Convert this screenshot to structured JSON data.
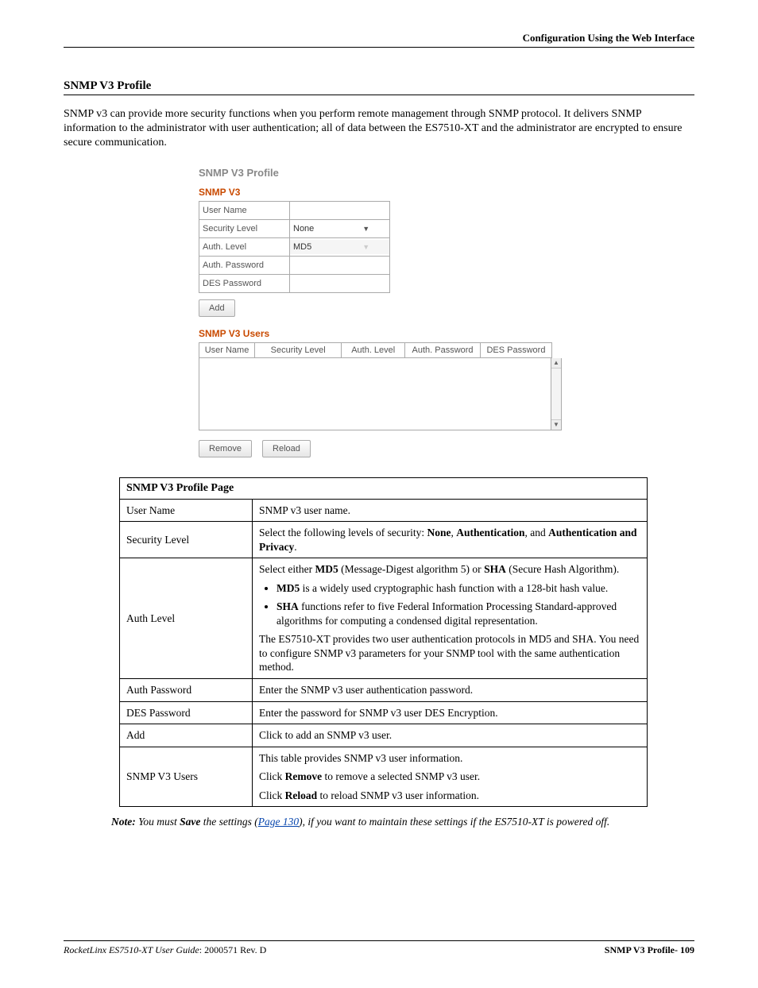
{
  "header": {
    "right_text": "Configuration Using the Web Interface"
  },
  "section": {
    "title": "SNMP V3 Profile",
    "intro": "SNMP v3 can provide more security functions when you perform remote management through SNMP protocol. It delivers SNMP information to the administrator with user authentication; all of data between the ES7510-XT and the administrator are encrypted to ensure secure communication."
  },
  "ui": {
    "panel_title": "SNMP V3 Profile",
    "snmp_v3_label": "SNMP V3",
    "form": {
      "user_name_label": "User Name",
      "user_name_value": "",
      "security_level_label": "Security Level",
      "security_level_value": "None",
      "auth_level_label": "Auth. Level",
      "auth_level_value": "MD5",
      "auth_password_label": "Auth. Password",
      "auth_password_value": "",
      "des_password_label": "DES Password",
      "des_password_value": ""
    },
    "add_button": "Add",
    "users_title": "SNMP V3 Users",
    "users_headers": {
      "c1": "User Name",
      "c2": "Security Level",
      "c3": "Auth. Level",
      "c4": "Auth. Password",
      "c5": "DES Password"
    },
    "remove_button": "Remove",
    "reload_button": "Reload"
  },
  "doc_table": {
    "title": "SNMP V3 Profile Page",
    "rows": {
      "user_name": {
        "label": "User Name",
        "desc": "SNMP v3 user name."
      },
      "security_level": {
        "label": "Security Level",
        "prefix": "Select the following levels of security: ",
        "b1": "None",
        "sep1": ", ",
        "b2": "Authentication",
        "sep2": ", and ",
        "b3": "Authentication and Privacy",
        "suffix": "."
      },
      "auth_level": {
        "label": "Auth Level",
        "line1_pre": "Select either ",
        "line1_b1": "MD5",
        "line1_mid": " (Message-Digest algorithm 5) or ",
        "line1_b2": "SHA",
        "line1_post": " (Secure Hash Algorithm).",
        "bullet1_b": "MD5",
        "bullet1_t": " is a widely used cryptographic hash function with a 128-bit hash value.",
        "bullet2_b": "SHA",
        "bullet2_t": " functions refer to five Federal Information Processing Standard-approved algorithms for computing a condensed digital representation.",
        "para2": "The ES7510-XT provides two user authentication protocols in MD5 and SHA. You need to configure SNMP v3 parameters for your SNMP tool with the same authentication method."
      },
      "auth_password": {
        "label": "Auth Password",
        "desc": "Enter the SNMP v3 user authentication password."
      },
      "des_password": {
        "label": "DES Password",
        "desc": "Enter the password for SNMP v3 user DES Encryption."
      },
      "add": {
        "label": "Add",
        "desc": "Click to add an SNMP v3 user."
      },
      "snmp_v3_users": {
        "label": "SNMP V3 Users",
        "line1": "This table provides SNMP v3 user information.",
        "line2_pre": "Click ",
        "line2_b": "Remove",
        "line2_post": " to remove a selected SNMP v3 user.",
        "line3_pre": "Click ",
        "line3_b": "Reload",
        "line3_post": " to reload SNMP v3 user information."
      }
    }
  },
  "note": {
    "label": "Note:",
    "pre": "  You must ",
    "b1": "Save",
    "mid1": " the settings (",
    "link": "Page 130",
    "mid2": "), if you want to maintain these settings if the ES7510-XT is powered off."
  },
  "footer": {
    "left_italic": "RocketLinx ES7510-XT  User Guide",
    "left_rest": ": 2000571 Rev. D",
    "right": "SNMP V3 Profile- 109"
  }
}
